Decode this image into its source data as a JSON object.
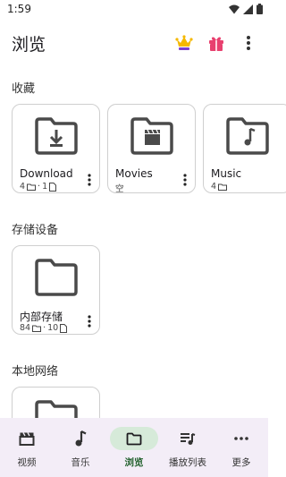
{
  "status_bar": {
    "time": "1:59"
  },
  "header": {
    "title": "浏览"
  },
  "sections": {
    "favorites": {
      "title": "收藏",
      "items": [
        {
          "name": "Download",
          "folders": "4",
          "files": "1",
          "sep": "·"
        },
        {
          "name": "Movies",
          "empty": "空"
        },
        {
          "name": "Music",
          "folders": "4"
        }
      ]
    },
    "storage": {
      "title": "存储设备",
      "items": [
        {
          "name": "内部存储",
          "folders": "84",
          "files": "10",
          "sep": "·"
        }
      ]
    },
    "network": {
      "title": "本地网络"
    }
  },
  "bottom_nav": {
    "items": [
      {
        "label": "视频",
        "icon": "clapperboard-icon"
      },
      {
        "label": "音乐",
        "icon": "music-note-icon"
      },
      {
        "label": "浏览",
        "icon": "folder-icon",
        "active": true
      },
      {
        "label": "播放列表",
        "icon": "playlist-icon"
      },
      {
        "label": "更多",
        "icon": "more-horizontal-icon"
      }
    ]
  },
  "colors": {
    "accent": "#1f5f2a",
    "nav_bg": "#f3edf7",
    "active_pill": "#d6ead9",
    "folder": "#4a4a4a"
  }
}
